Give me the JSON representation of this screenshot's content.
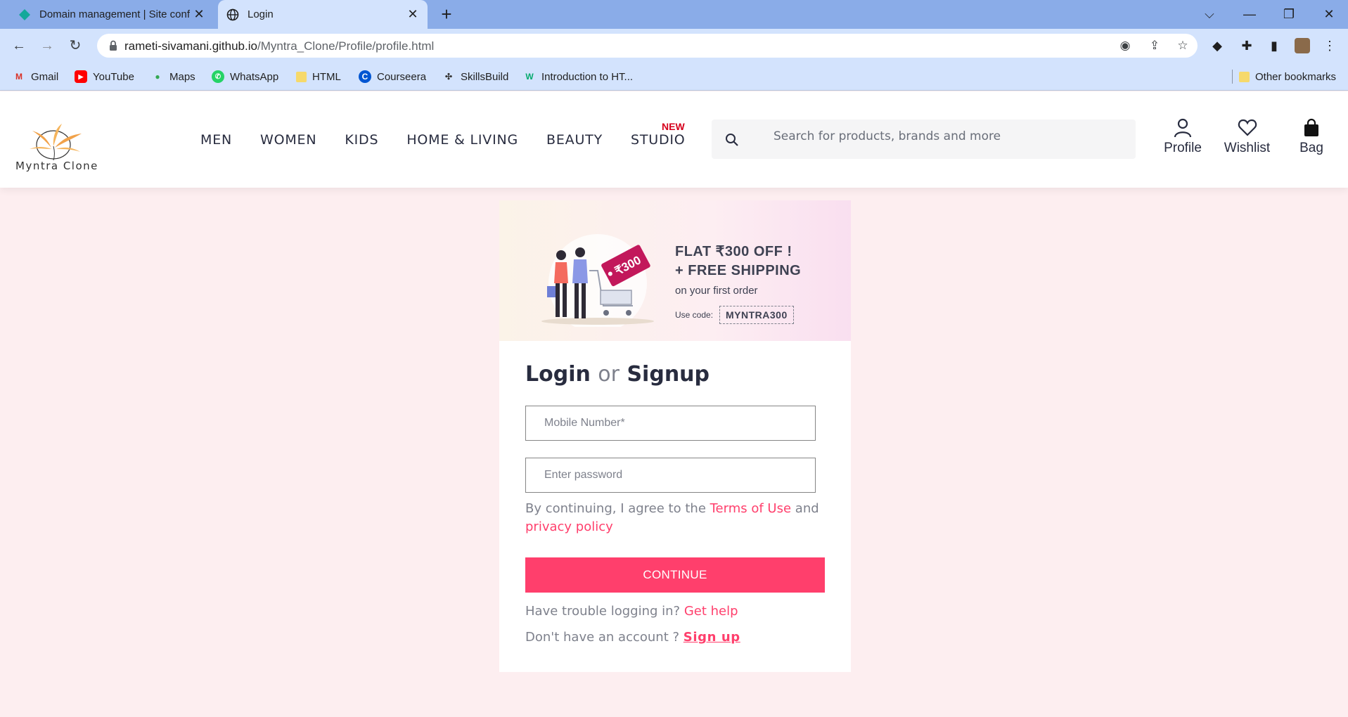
{
  "browser": {
    "tabs": [
      {
        "title": "Domain management | Site confi",
        "active": false
      },
      {
        "title": "Login",
        "active": true
      }
    ],
    "url_host": "rameti-sivamani.github.io",
    "url_path": "/Myntra_Clone/Profile/profile.html",
    "bookmarks": [
      "Gmail",
      "YouTube",
      "Maps",
      "WhatsApp",
      "HTML",
      "Courseera",
      "SkillsBuild",
      "Introduction to HT..."
    ],
    "other_bookmarks": "Other bookmarks"
  },
  "site": {
    "logo_text": "Myntra Clone",
    "nav": [
      "MEN",
      "WOMEN",
      "KIDS",
      "HOME & LIVING",
      "BEAUTY",
      "STUDIO"
    ],
    "nav_badge": "NEW",
    "search_placeholder": "Search for products, brands and more",
    "actions": {
      "profile": "Profile",
      "wishlist": "Wishlist",
      "bag": "Bag"
    }
  },
  "banner": {
    "line1": "FLAT ₹300 OFF !",
    "line2": "+ FREE SHIPPING",
    "line3": "on your first order",
    "code_label": "Use code:",
    "code": "MYNTRA300",
    "tag_text": "₹300"
  },
  "login": {
    "title_login": "Login",
    "title_or": "or",
    "title_signup": "Signup",
    "mobile_placeholder": "Mobile Number*",
    "password_placeholder": "Enter password",
    "terms_prefix": "By continuing, I agree to the",
    "terms_link": "Terms of Use",
    "terms_and": "and",
    "privacy_link": "privacy policy",
    "continue_label": "CONTINUE",
    "trouble_text": "Have trouble logging in?",
    "get_help": "Get help",
    "no_account": "Don't have an account ?",
    "sign_up": "Sign up"
  },
  "colors": {
    "accent": "#ff3f6c",
    "page_bg": "#fdeef0",
    "chrome": "#d3e3fd",
    "tabbar": "#8aace8"
  }
}
